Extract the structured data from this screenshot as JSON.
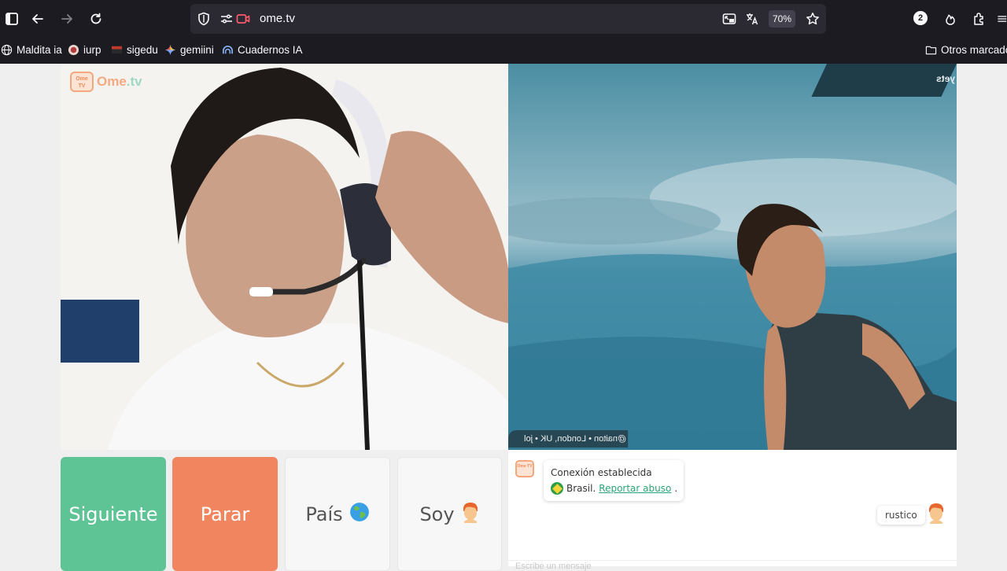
{
  "browser": {
    "url": "ome.tv",
    "zoom": "70%",
    "notification_count": "2",
    "bookmarks": [
      {
        "label": "Maldita ia",
        "icon": "globe-icon"
      },
      {
        "label": "iurp",
        "icon": "site-favicon"
      },
      {
        "label": "sigedu",
        "icon": "site-favicon"
      },
      {
        "label": "gemiini",
        "icon": "gemini-sparkle-icon"
      },
      {
        "label": "Cuadernos IA",
        "icon": "notebook-icon"
      }
    ],
    "other_bookmarks": "Otros marcador"
  },
  "site": {
    "logo_ome": "Ome",
    "logo_tv": ".tv",
    "logo_badge": "Ome TV"
  },
  "buttons": {
    "next": "Siguiente",
    "stop": "Parar",
    "country": "País",
    "iam": "Soy"
  },
  "chat": {
    "status": "Conexión establecida",
    "country": "Brasil.",
    "report": "Reportar abuso",
    "report_suffix": ".",
    "username": "rustico",
    "input_placeholder": "Escribe un mensaje"
  },
  "remote_video": {
    "caption": "@naiton • London, UK • jol",
    "corner_tag": "yets"
  },
  "colors": {
    "next": "#5fc495",
    "stop": "#f0855f",
    "accent_link": "#2aa476",
    "chrome": "#1c1b22"
  }
}
